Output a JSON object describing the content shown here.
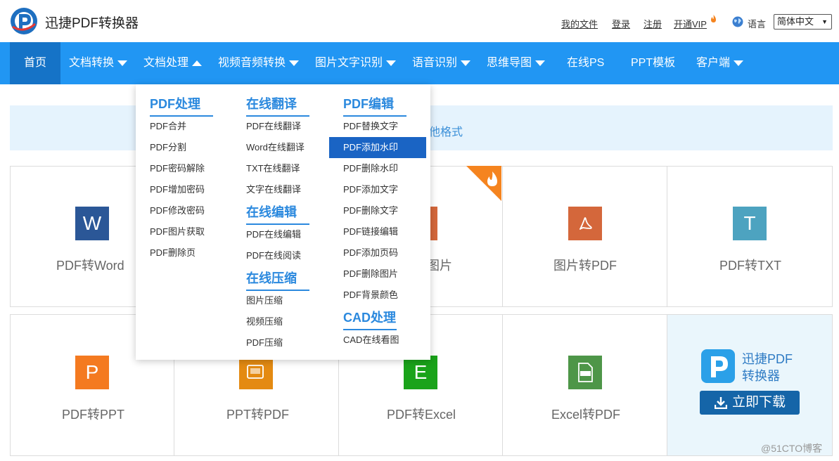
{
  "header": {
    "app_title": "迅捷PDF转换器",
    "links": {
      "my_files": "我的文件",
      "login": "登录",
      "register": "注册",
      "vip": "开通VIP",
      "language": "语言"
    },
    "language_select": "简体中文"
  },
  "nav": {
    "home": "首页",
    "doc_convert": "文档转换",
    "doc_process": "文档处理",
    "video_audio": "视频音频转换",
    "image_ocr": "图片文字识别",
    "speech": "语音识别",
    "mindmap": "思维导图",
    "online_ps": "在线PS",
    "ppt_template": "PPT模板",
    "client": "客户端"
  },
  "banner": {
    "text": "他格式"
  },
  "dropdown": {
    "col1": {
      "head": "PDF处理",
      "items": [
        "PDF合并",
        "PDF分割",
        "PDF密码解除",
        "PDF增加密码",
        "PDF修改密码",
        "PDF图片获取",
        "PDF删除页"
      ]
    },
    "col2": {
      "translate_head": "在线翻译",
      "translate_items": [
        "PDF在线翻译",
        "Word在线翻译",
        "TXT在线翻译",
        "文字在线翻译"
      ],
      "edit_head": "在线编辑",
      "edit_items": [
        "PDF在线编辑",
        "PDF在线阅读"
      ],
      "compress_head": "在线压缩",
      "compress_items": [
        "图片压缩",
        "视频压缩",
        "PDF压缩"
      ]
    },
    "col3": {
      "edit_head": "PDF编辑",
      "edit_items": [
        "PDF替换文字",
        "PDF添加水印",
        "PDF删除水印",
        "PDF添加文字",
        "PDF删除文字",
        "PDF链接编辑",
        "PDF添加页码",
        "PDF删除图片",
        "PDF背景颜色"
      ],
      "cad_head": "CAD处理",
      "cad_items": [
        "CAD在线看图"
      ]
    }
  },
  "cards": {
    "pdf_word": {
      "label": "PDF转Word",
      "glyph": "W"
    },
    "pdf_image": {
      "label": "图片"
    },
    "image_pdf": {
      "label": "图片转PDF"
    },
    "pdf_txt": {
      "label": "PDF转TXT",
      "glyph": "T"
    },
    "pdf_ppt": {
      "label": "PDF转PPT",
      "glyph": "P"
    },
    "ppt_pdf": {
      "label": "PPT转PDF"
    },
    "pdf_excel": {
      "label": "PDF转Excel",
      "glyph": "E"
    },
    "excel_pdf": {
      "label": "Excel转PDF"
    }
  },
  "download": {
    "name_line1": "迅捷PDF",
    "name_line2": "转换器",
    "button": "立即下载"
  },
  "watermark": "@51CTO博客",
  "colors": {
    "nav_bg": "#2196f3",
    "nav_active": "#1573c7",
    "accent": "#2b89de",
    "word": "#2b5797",
    "pdf_orange": "#d4673b",
    "txt": "#4da3c0",
    "ppt": "#f47a20",
    "ppt_pdf": "#e48a12",
    "excel": "#1aa31a",
    "excel_pdf": "#4e9648"
  }
}
